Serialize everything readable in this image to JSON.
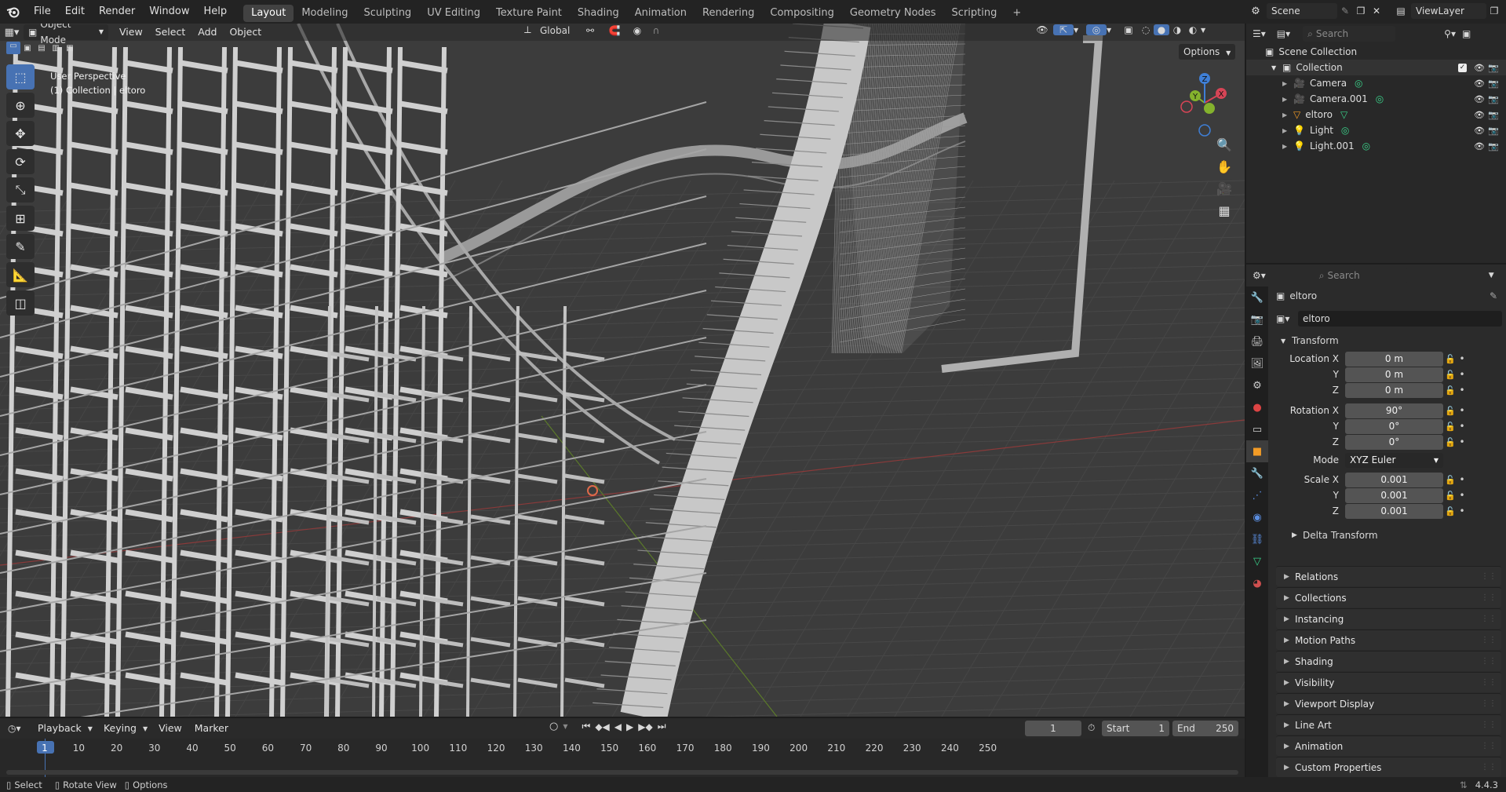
{
  "topbar": {
    "menus": [
      "File",
      "Edit",
      "Render",
      "Window",
      "Help"
    ],
    "workspaces": [
      "Layout",
      "Modeling",
      "Sculpting",
      "UV Editing",
      "Texture Paint",
      "Shading",
      "Animation",
      "Rendering",
      "Compositing",
      "Geometry Nodes",
      "Scripting"
    ],
    "active_workspace": "Layout",
    "add_tab": "+",
    "scene": "Scene",
    "view_layer": "ViewLayer"
  },
  "viewport": {
    "mode": "Object Mode",
    "menus": [
      "View",
      "Select",
      "Add",
      "Object"
    ],
    "orientation": "Global",
    "options": "Options",
    "info_line1": "User Perspective",
    "info_line2": "(1) Collection | eltoro",
    "gizmo": {
      "x": "X",
      "y": "Y",
      "z": "Z"
    }
  },
  "outliner": {
    "search_placeholder": "Search",
    "root": "Scene Collection",
    "collection": "Collection",
    "items": [
      {
        "name": "Camera"
      },
      {
        "name": "Camera.001"
      },
      {
        "name": "eltoro"
      },
      {
        "name": "Light"
      },
      {
        "name": "Light.001"
      }
    ]
  },
  "properties": {
    "search_placeholder": "Search",
    "object_name": "eltoro",
    "datablock": "eltoro",
    "transform_label": "Transform",
    "location_label": "Location X",
    "rotation_label": "Rotation X",
    "scale_label": "Scale X",
    "y_label": "Y",
    "z_label": "Z",
    "location": [
      "0 m",
      "0 m",
      "0 m"
    ],
    "rotation": [
      "90°",
      "0°",
      "0°"
    ],
    "mode_label": "Mode",
    "mode_value": "XYZ Euler",
    "scale": [
      "0.001",
      "0.001",
      "0.001"
    ],
    "delta": "Delta Transform",
    "panels": [
      "Relations",
      "Collections",
      "Instancing",
      "Motion Paths",
      "Shading",
      "Visibility",
      "Viewport Display",
      "Line Art",
      "Animation",
      "Custom Properties"
    ]
  },
  "timeline": {
    "menus": [
      "Playback",
      "Keying",
      "View",
      "Marker"
    ],
    "current_frame": "1",
    "start_label": "Start",
    "start": "1",
    "end_label": "End",
    "end": "250",
    "ticks": [
      "1",
      "10",
      "20",
      "30",
      "40",
      "50",
      "60",
      "70",
      "80",
      "90",
      "100",
      "110",
      "120",
      "130",
      "140",
      "150",
      "160",
      "170",
      "180",
      "190",
      "200",
      "210",
      "220",
      "230",
      "240",
      "250"
    ]
  },
  "statusbar": {
    "select": "Select",
    "rotate": "Rotate View",
    "options": "Options",
    "version": "4.4.3"
  }
}
